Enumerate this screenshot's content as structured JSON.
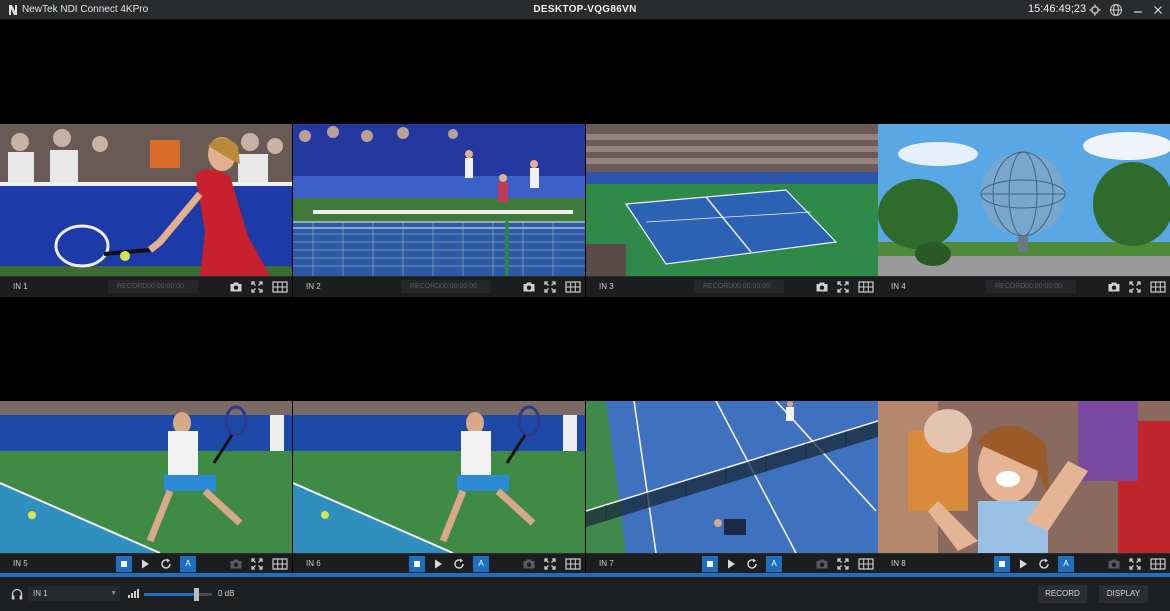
{
  "window": {
    "app_title": "NewTek NDI Connect 4KPro",
    "machine_name": "DESKTOP-VQG86VN",
    "clock": "15:46:49;23",
    "controls": {
      "minimize": "–",
      "close": "✕"
    }
  },
  "tiles": [
    {
      "label": "IN 1",
      "record_label": "RECORD",
      "record_time": "00:00:00:00"
    },
    {
      "label": "IN 2",
      "record_label": "RECORD",
      "record_time": "00:00:00:00"
    },
    {
      "label": "IN 3",
      "record_label": "RECORD",
      "record_time": "00:00:00:00"
    },
    {
      "label": "IN 4",
      "record_label": "RECORD",
      "record_time": "00:00:00:00"
    },
    {
      "label": "IN 5",
      "a_label": "A"
    },
    {
      "label": "IN 6",
      "a_label": "A"
    },
    {
      "label": "IN 7",
      "a_label": "A"
    },
    {
      "label": "IN 8",
      "a_label": "A"
    }
  ],
  "footer": {
    "audio_source": "IN 1",
    "volume_db": "0 dB",
    "volume_level": 0.76,
    "record_button": "RECORD",
    "display_button": "DISPLAY"
  },
  "colors": {
    "accent": "#1f6fc0",
    "bar": "#1c1d1f",
    "titlebar": "#2a2b2d"
  }
}
